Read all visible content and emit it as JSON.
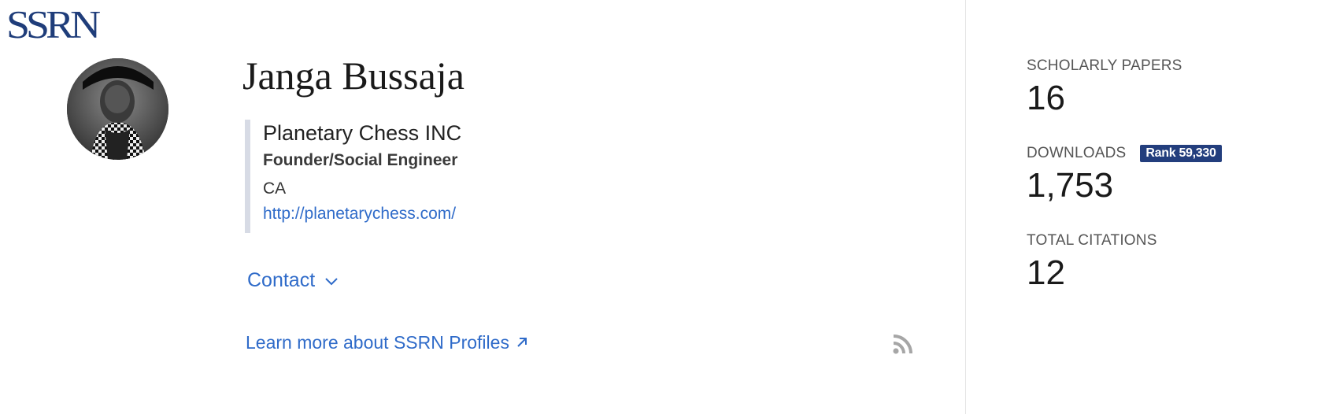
{
  "logo": {
    "text": "SSRN",
    "color": "#1f3d7a"
  },
  "profile": {
    "name": "Janga Bussaja",
    "organization": "Planetary Chess INC",
    "role": "Founder/Social Engineer",
    "location": "CA",
    "url": "http://planetarychess.com/",
    "avatar_icon": "person-photo"
  },
  "actions": {
    "contact_label": "Contact",
    "contact_icon": "chevron-down-icon",
    "learn_more_label": "Learn more about SSRN Profiles",
    "learn_more_icon": "external-arrow-icon",
    "rss_icon": "rss-icon"
  },
  "stats": {
    "papers": {
      "label": "SCHOLARLY PAPERS",
      "value": "16"
    },
    "downloads": {
      "label": "DOWNLOADS",
      "value": "1,753",
      "rank": "Rank 59,330"
    },
    "citations": {
      "label": "TOTAL CITATIONS",
      "value": "12"
    }
  },
  "colors": {
    "link": "#2f6bc9",
    "badge": "#233e7d",
    "affiliation_bar": "#d7dbe5"
  }
}
